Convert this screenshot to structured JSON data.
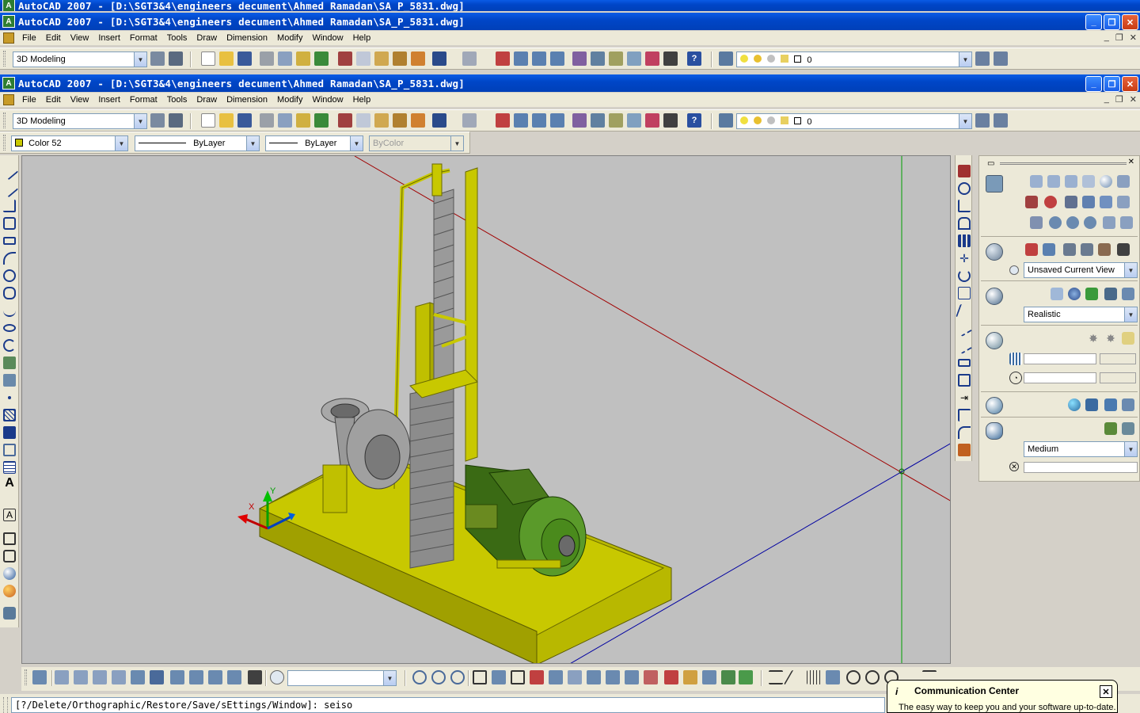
{
  "windows": [
    {
      "title": "AutoCAD 2007 - [D:\\SGT3&4\\engineers decument\\Ahmed Ramadan\\SA_P_5831.dwg]",
      "menus": [
        "File",
        "Edit",
        "View",
        "Insert",
        "Format",
        "Tools",
        "Draw",
        "Dimension",
        "Modify",
        "Window",
        "Help"
      ],
      "workspace": "3D Modeling",
      "layer": "0"
    },
    {
      "title": "AutoCAD 2007 - [D:\\SGT3&4\\engineers decument\\Ahmed Ramadan\\SA_P_5831.dwg]",
      "menus": [
        "File",
        "Edit",
        "View",
        "Insert",
        "Format",
        "Tools",
        "Draw",
        "Dimension",
        "Modify",
        "Window",
        "Help"
      ],
      "workspace": "3D Modeling",
      "layer": "0"
    }
  ],
  "background_title": "AutoCAD 2007 - [D:\\SGT3&4\\engineers decument\\Ahmed Ramadan\\SA_P_5831.dwg]",
  "properties": {
    "color": "Color 52",
    "linetype": "ByLayer",
    "lineweight": "ByLayer",
    "plotstyle": "ByColor"
  },
  "dashboard": {
    "view_name": "Unsaved Current View",
    "visual_style": "Realistic",
    "render_quality": "Medium"
  },
  "ucs_labels": {
    "x": "X",
    "y": "Y"
  },
  "command_line": "[?/Delete/Orthographic/Restore/Save/sEttings/Window]:  seiso",
  "communication_center": {
    "title": "Communication Center",
    "body": "The easy way to keep you and your software up-to-date."
  },
  "colors": {
    "model_yellow": "#c8c800",
    "motor_green": "#4a8c1c",
    "viewport_bg": "#c0c0c0",
    "titlebar_blue": "#0046c8"
  }
}
